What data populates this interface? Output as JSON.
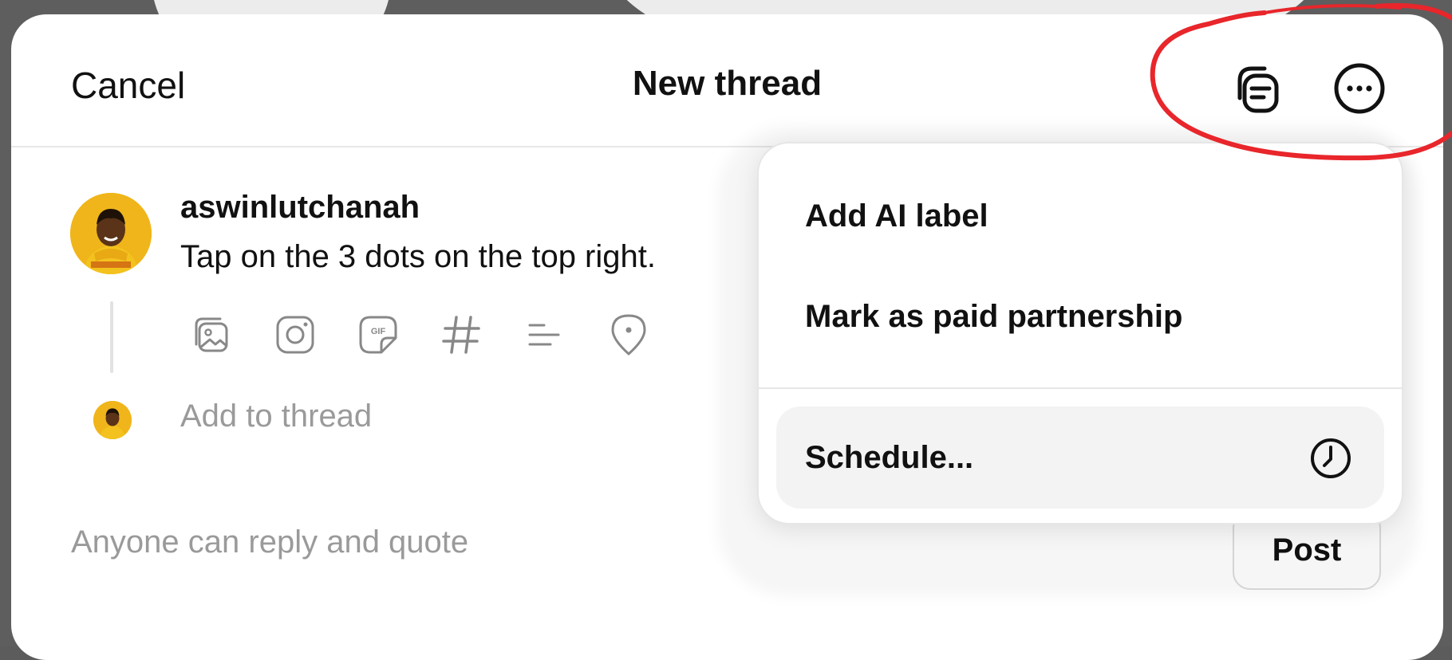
{
  "header": {
    "cancel_label": "Cancel",
    "title": "New thread",
    "drafts_icon": "drafts-stack-icon",
    "more_icon": "more-options-icon"
  },
  "composer": {
    "username": "aswinlutchanah",
    "post_text": "Tap on the 3 dots on the top right.",
    "attachment_icons": [
      "gallery-icon",
      "camera-icon",
      "gif-icon",
      "hashtag-icon",
      "poll-icon",
      "location-icon"
    ],
    "add_to_thread_placeholder": "Add to thread",
    "reply_setting": "Anyone can reply and quote",
    "post_label": "Post"
  },
  "menu": {
    "items": [
      {
        "label": "Add AI label"
      },
      {
        "label": "Mark as paid partnership"
      },
      {
        "label": "Schedule...",
        "icon": "clock-icon",
        "highlighted": true
      }
    ]
  },
  "colors": {
    "backdrop": "#5e5e5e",
    "modal": "#ffffff",
    "text": "#111111",
    "muted_text": "#9a9a9a",
    "highlight": "#f3f3f3",
    "annotation": "#e8262b",
    "avatar": "#f0b51a"
  }
}
